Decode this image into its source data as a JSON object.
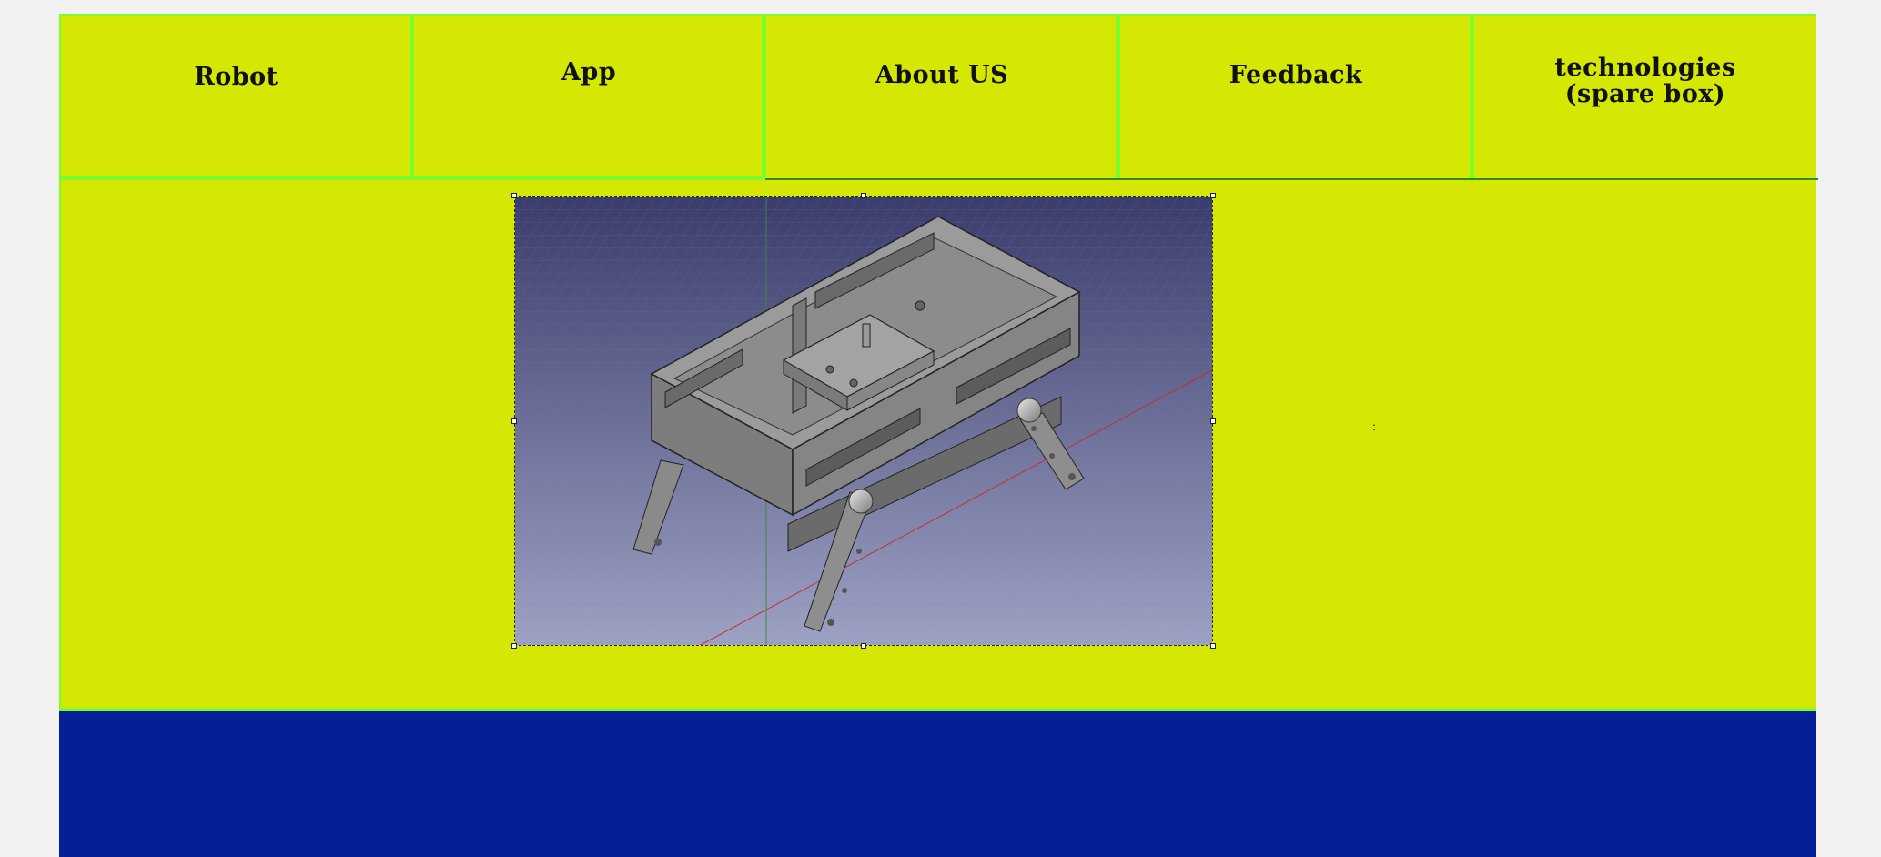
{
  "nav": {
    "items": [
      {
        "label": "Robot"
      },
      {
        "label": "App"
      },
      {
        "label": "About US"
      },
      {
        "label": "Feedback"
      },
      {
        "label": "technologies (spare box)"
      }
    ]
  },
  "main": {
    "image_alt": "3D CAD model of a four-legged robot chassis",
    "side_text": ":"
  },
  "colors": {
    "nav_bg": "#d4e804",
    "border_green": "#7cfc2a",
    "footer_bg": "#051f96",
    "page_bg": "#f2f2f2"
  }
}
